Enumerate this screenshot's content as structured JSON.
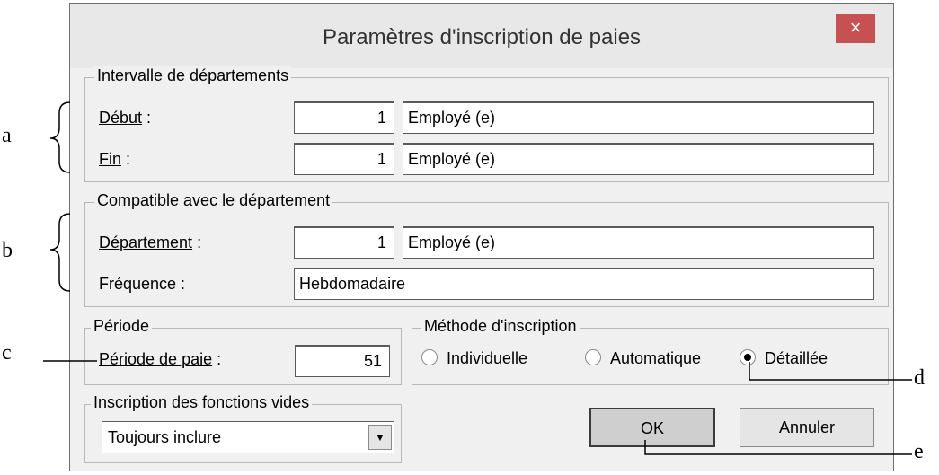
{
  "annotations": {
    "a": "a",
    "b": "b",
    "c": "c",
    "d": "d",
    "e": "e"
  },
  "dialog": {
    "title": "Paramètres d'inscription de paies",
    "close_icon": "×"
  },
  "range_group": {
    "legend": "Intervalle de départements",
    "start": {
      "label_u": "Début",
      "label_rest": " :",
      "number": "1",
      "name": "Employé (e)"
    },
    "end": {
      "label_u": "Fin",
      "label_rest": " :",
      "number": "1",
      "name": "Employé (e)"
    }
  },
  "compat_group": {
    "legend": "Compatible avec le département",
    "department": {
      "label_u": "Département",
      "label_rest": " :",
      "number": "1",
      "name": "Employé (e)"
    },
    "frequency": {
      "label": "Fréquence :",
      "value": "Hebdomadaire"
    }
  },
  "period_group": {
    "legend": "Période",
    "label_u": "Période de paie",
    "label_rest": " :",
    "value": "51"
  },
  "method_group": {
    "legend": "Méthode d'inscription",
    "options": [
      "Individuelle",
      "Automatique",
      "Détaillée"
    ],
    "selected": "Détaillée"
  },
  "empty_group": {
    "legend": "Inscription des fonctions vides",
    "selected": "Toujours inclure"
  },
  "buttons": {
    "ok": "OK",
    "cancel": "Annuler"
  }
}
